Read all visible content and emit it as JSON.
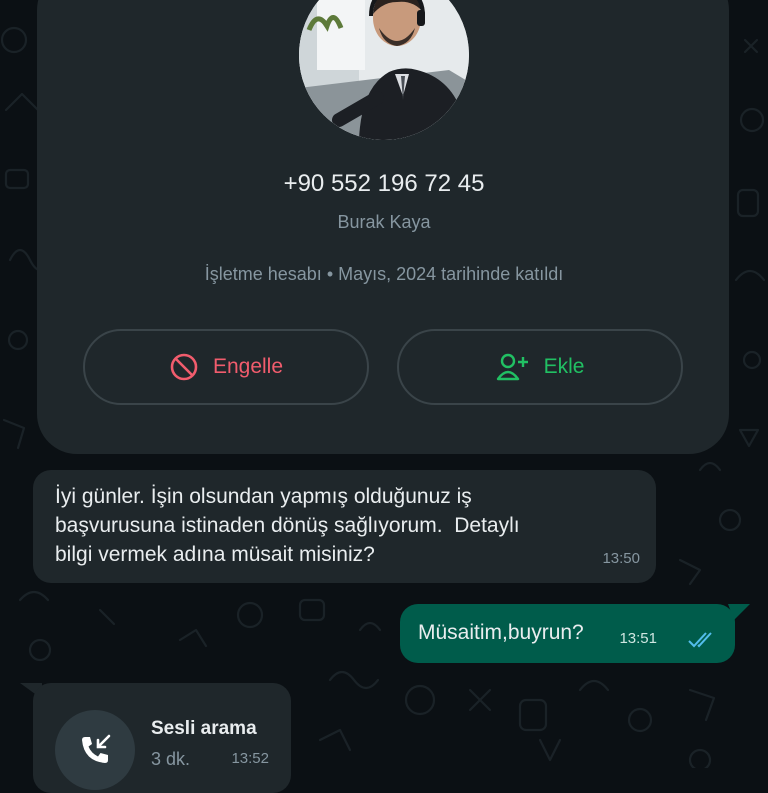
{
  "contact": {
    "phone": "+90 552 196 72 45",
    "name": "Burak Kaya",
    "info": "İşletme hesabı • Mayıs, 2024 tarihinde katıldı"
  },
  "actions": {
    "block_label": "Engelle",
    "add_label": "Ekle"
  },
  "messages": [
    {
      "direction": "incoming",
      "text": "İyi günler. İşin olsundan yapmış olduğunuz iş\nbaşvurusuna istinaden dönüş sağlıyorum.  Detaylı\nbilgi vermek adına müsait misiniz?",
      "time": "13:50"
    },
    {
      "direction": "outgoing",
      "text": "Müsaitim,buyrun?",
      "time": "13:51",
      "status": "read"
    }
  ],
  "call": {
    "title": "Sesli arama",
    "duration": "3 dk.",
    "time": "13:52"
  },
  "colors": {
    "background": "#0b1014",
    "card": "#1f272b",
    "outgoing_bubble": "#005c4b",
    "block_red": "#f15c6d",
    "add_green": "#21c063",
    "read_ticks": "#53bdeb"
  }
}
